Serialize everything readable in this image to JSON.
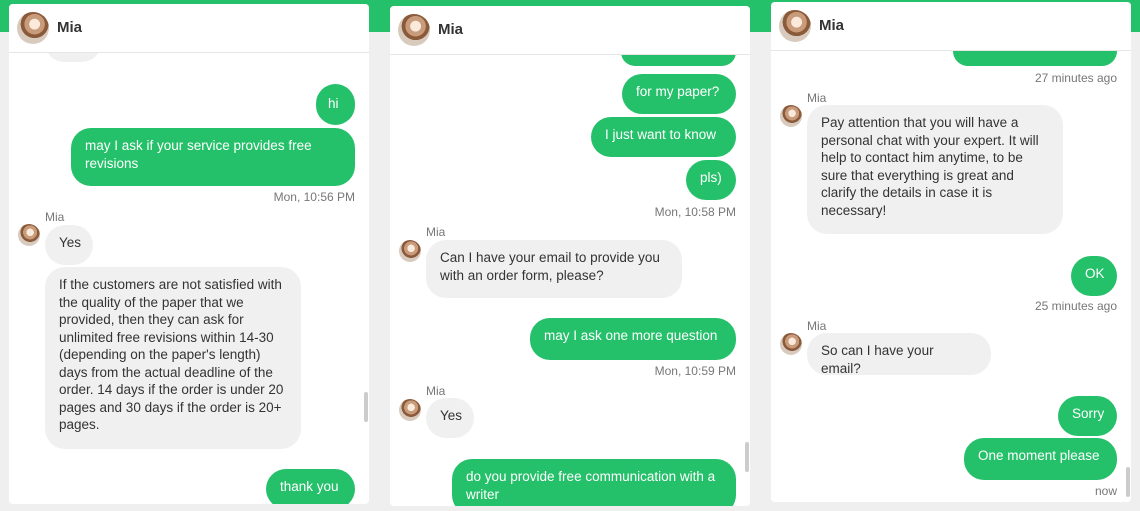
{
  "brand_color": "#25c06a",
  "panel1": {
    "contact": "Mia",
    "messages": {
      "hi": "hi",
      "ask_free_revisions": "may I ask if your service provides free revisions",
      "ts1": "Mon, 10:56 PM",
      "sender": "Mia",
      "yes": "Yes",
      "revisions_answer": "If the customers are not satisfied with the quality of the paper that we provided, then they can ask for unlimited free revisions within 14-30 (depending on the paper's length) days from the actual deadline of the order. 14 days if the order is under 20 pages and 30 days if the order is 20+ pages.",
      "thank_you": "thank you"
    }
  },
  "panel2": {
    "contact": "Mia",
    "messages": {
      "for_my_paper": "for my paper?",
      "just_want": "I just want to know",
      "pls": "pls)",
      "ts1": "Mon, 10:58 PM",
      "sender1": "Mia",
      "email_request": "Can I have your email to provide you with an order form, please?",
      "one_more": "may I ask one more question",
      "ts2": "Mon, 10:59 PM",
      "sender2": "Mia",
      "yes": "Yes",
      "free_comm": "do you provide free communication with a writer"
    }
  },
  "panel3": {
    "contact": "Mia",
    "messages": {
      "ts0": "27 minutes ago",
      "sender1": "Mia",
      "expert_chat": "Pay attention that you will have a personal chat with your expert. It will help to contact him anytime, to be sure that everything is great and clarify the details in case it is necessary!",
      "ok": "OK",
      "ts1": "25 minutes ago",
      "sender2": "Mia",
      "email_again": "So can I have your email?",
      "sorry": "Sorry",
      "one_moment": "One moment please",
      "ts2": "now"
    }
  }
}
